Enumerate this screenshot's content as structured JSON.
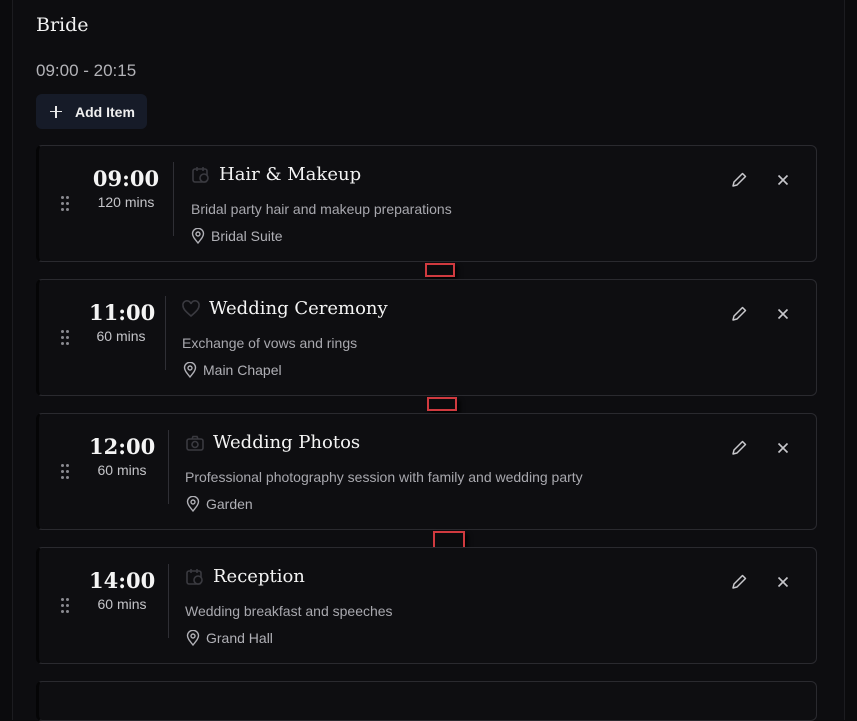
{
  "header": {
    "title": "Bride",
    "time_range": "09:00 - 20:15",
    "add_label": "Add Item"
  },
  "items": [
    {
      "time": "09:00",
      "duration": "120 mins",
      "icon": "calendar-clock-icon",
      "name": "Hair & Makeup",
      "description": "Bridal party hair and makeup preparations",
      "location": "Bridal Suite"
    },
    {
      "time": "11:00",
      "duration": "60 mins",
      "icon": "heart-icon",
      "name": "Wedding Ceremony",
      "description": "Exchange of vows and rings",
      "location": "Main Chapel"
    },
    {
      "time": "12:00",
      "duration": "60 mins",
      "icon": "camera-icon",
      "name": "Wedding Photos",
      "description": "Professional photography session with family and wedding party",
      "location": "Garden"
    },
    {
      "time": "14:00",
      "duration": "60 mins",
      "icon": "calendar-clock-icon",
      "name": "Reception",
      "description": "Wedding breakfast and speeches",
      "location": "Grand Hall"
    }
  ],
  "colors": {
    "background": "#0b0b0d",
    "card_border": "#2a2a2f",
    "button_bg": "#161b28",
    "connector_outline": "#d03a3f"
  }
}
